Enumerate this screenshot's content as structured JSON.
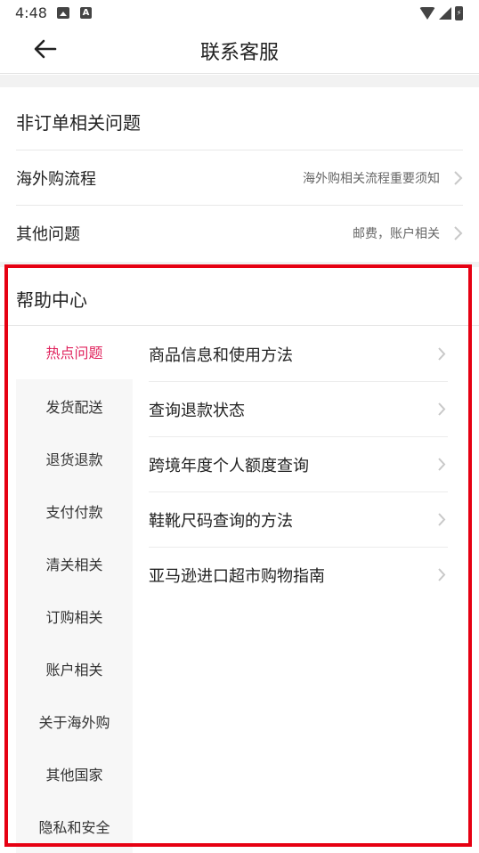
{
  "status_bar": {
    "time": "4:48",
    "left_icons": [
      "image-icon",
      "a-badge-icon"
    ],
    "right_icons": [
      "wifi-icon",
      "signal-icon",
      "battery-charging-icon"
    ]
  },
  "header": {
    "title": "联系客服",
    "back_icon": "arrow-left-icon"
  },
  "non_order": {
    "heading": "非订单相关问题",
    "rows": [
      {
        "title": "海外购流程",
        "value": "海外购相关流程重要须知"
      },
      {
        "title": "其他问题",
        "value": "邮费，账户相关"
      }
    ]
  },
  "help_center": {
    "heading": "帮助中心",
    "categories": [
      {
        "label": "热点问题",
        "active": true
      },
      {
        "label": "发货配送",
        "active": false
      },
      {
        "label": "退货退款",
        "active": false
      },
      {
        "label": "支付付款",
        "active": false
      },
      {
        "label": "清关相关",
        "active": false
      },
      {
        "label": "订购相关",
        "active": false
      },
      {
        "label": "账户相关",
        "active": false
      },
      {
        "label": "关于海外购",
        "active": false
      },
      {
        "label": "其他国家",
        "active": false
      },
      {
        "label": "隐私和安全",
        "active": false
      }
    ],
    "questions": [
      "商品信息和使用方法",
      "查询退款状态",
      "跨境年度个人额度查询",
      "鞋靴尺码查询的方法",
      "亚马逊进口超市购物指南"
    ]
  },
  "colors": {
    "active_category": "#e0245e",
    "highlight_border": "#e60012",
    "page_background": "#ffffff",
    "band_background": "#f2f2f2",
    "category_column_background": "#f7f7f7"
  }
}
